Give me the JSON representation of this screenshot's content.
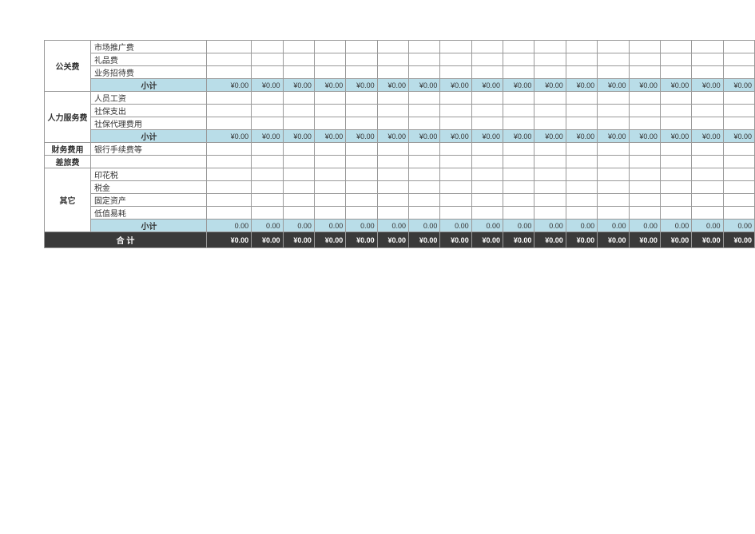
{
  "labels": {
    "subtotal": "小计",
    "total": "合  计"
  },
  "sections": [
    {
      "category": "公关费",
      "items": [
        "市场推广费",
        "礼品费",
        "业务招待费"
      ],
      "subtotal_format": "currency",
      "has_subtotal": true
    },
    {
      "category": "人力服务费",
      "items": [
        "人员工资",
        "社保支出",
        "社保代理费用"
      ],
      "subtotal_format": "currency",
      "has_subtotal": true
    },
    {
      "category": "财务费用",
      "items": [
        "银行手续费等"
      ],
      "has_subtotal": false
    },
    {
      "category": "差旅费",
      "items": [
        ""
      ],
      "has_subtotal": false,
      "single_blank": true
    },
    {
      "category": "其它",
      "items": [
        "印花税",
        "税金",
        "固定资产",
        "低值易耗"
      ],
      "subtotal_format": "plain",
      "has_subtotal": true
    }
  ],
  "value_columns": 17,
  "subtotal_currency": "¥0.00",
  "subtotal_plain": "0.00",
  "grand_total": "¥0.00"
}
